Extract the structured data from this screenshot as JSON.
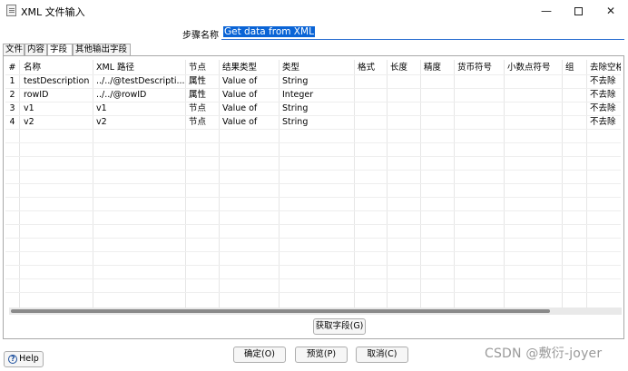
{
  "window": {
    "title": "XML 文件输入",
    "minimize_glyph": "—",
    "close_glyph": "✕"
  },
  "step_name": {
    "label": "步骤名称",
    "value": "Get data from XML"
  },
  "tabs": [
    {
      "label": "文件",
      "active": false
    },
    {
      "label": "内容",
      "active": false
    },
    {
      "label": "字段",
      "active": true
    },
    {
      "label": "其他输出字段",
      "active": false
    }
  ],
  "table": {
    "columns": [
      "#",
      "名称",
      "XML 路径",
      "节点",
      "结果类型",
      "类型",
      "格式",
      "长度",
      "精度",
      "货币符号",
      "小数点符号",
      "组",
      "去除空格"
    ],
    "rows": [
      [
        "1",
        "testDescription",
        "../../@testDescripti...",
        "属性",
        "Value of",
        "String",
        "",
        "",
        "",
        "",
        "",
        "",
        "不去除"
      ],
      [
        "2",
        "rowID",
        "../../@rowID",
        "属性",
        "Value of",
        "Integer",
        "",
        "",
        "",
        "",
        "",
        "",
        "不去除"
      ],
      [
        "3",
        "v1",
        "v1",
        "节点",
        "Value of",
        "String",
        "",
        "",
        "",
        "",
        "",
        "",
        "不去除"
      ],
      [
        "4",
        "v2",
        "v2",
        "节点",
        "Value of",
        "String",
        "",
        "",
        "",
        "",
        "",
        "",
        "不去除"
      ]
    ],
    "horizontal_scroll_fraction": 0.88
  },
  "buttons": {
    "get_fields": "获取字段(G)",
    "ok": "确定(O)",
    "preview": "预览(P)",
    "cancel": "取消(C)",
    "help": "Help",
    "help_icon_glyph": "?"
  },
  "watermark": "CSDN @敷衍-joyer",
  "colors": {
    "selection": "#0a64d6",
    "input_underline": "#2c6fd1"
  }
}
